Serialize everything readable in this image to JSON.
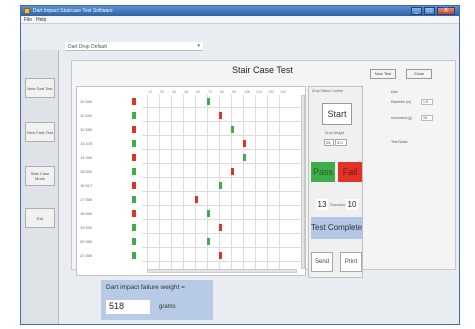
{
  "window": {
    "title": "Dart Impact Staircase Test Software",
    "buttons": [
      "_",
      "□",
      "X"
    ]
  },
  "menubar": {
    "items": [
      "File",
      "Help"
    ]
  },
  "left_nav": {
    "items": [
      "New Dart Test",
      "New Falls Test",
      "Stair Case Mode",
      "Exit"
    ]
  },
  "drop_select": {
    "value": "Dart Drop Default"
  },
  "main": {
    "title": "Stair Case Test",
    "new_test_label": "New Test",
    "close_label": "Close"
  },
  "grid": {
    "column_headers": [
      "12",
      "24",
      "36",
      "48",
      "60",
      "72",
      "84",
      "96",
      "108",
      "120",
      "132",
      "144"
    ],
    "rows": [
      {
        "num": "10",
        "weight": "500"
      },
      {
        "num": "11",
        "weight": "542"
      },
      {
        "num": "12",
        "weight": "500"
      },
      {
        "num": "13",
        "weight": "475"
      },
      {
        "num": "14",
        "weight": "500"
      },
      {
        "num": "15",
        "weight": "542"
      },
      {
        "num": "16",
        "weight": "517"
      },
      {
        "num": "17",
        "weight": "500"
      },
      {
        "num": "18",
        "weight": "500"
      },
      {
        "num": "19",
        "weight": "542"
      },
      {
        "num": "20",
        "weight": "500"
      },
      {
        "num": "21",
        "weight": "500"
      }
    ],
    "pass_color": "#3fae4a",
    "fail_color": "#e23126"
  },
  "control": {
    "header": "Drop Status Control",
    "start_label": "Start",
    "drop_weight_label": "Drop Weight",
    "drop_weight_value": "25",
    "drop_weight_unit": "3.0",
    "pass_label": "Pass",
    "fail_label": "Fail",
    "pass_count": "13",
    "count_separator": "Success",
    "fail_count": "10",
    "status": "Test Complete",
    "send_label": "Send",
    "print_label": "Print"
  },
  "right_info": {
    "section": "Dart",
    "diameter_label": "Diameter (in)",
    "diameter_value": "1.5",
    "increment_label": "Increment (g)",
    "increment_value": "15",
    "test_notes_label": "Test Notes"
  },
  "result": {
    "label": "Dart impact failure weight =",
    "value": "518",
    "unit": "grams"
  }
}
